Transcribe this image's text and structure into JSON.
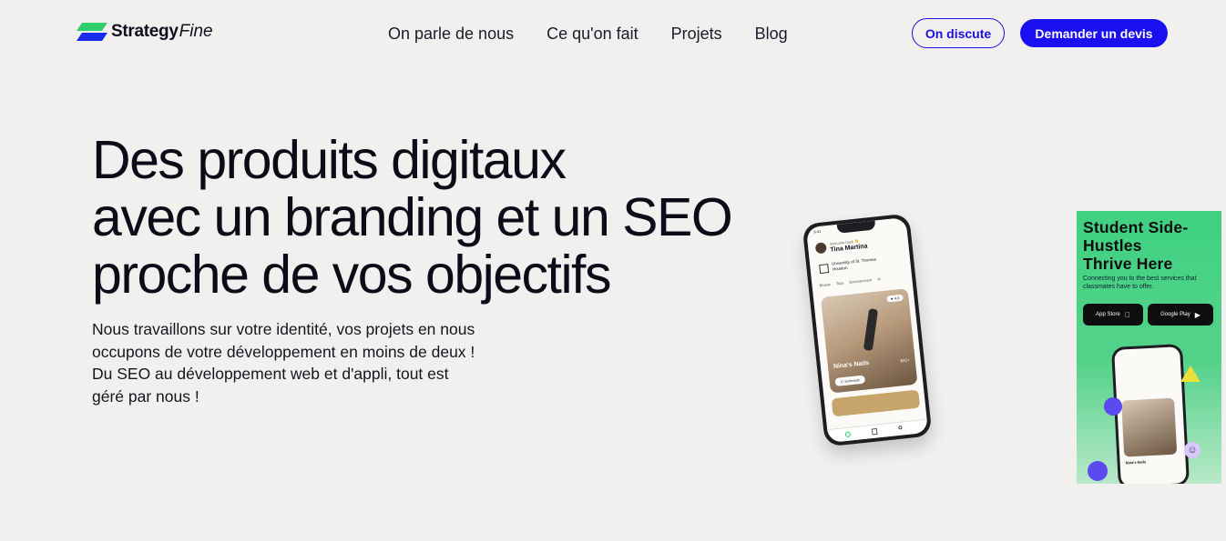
{
  "header": {
    "logo": {
      "strong": "Strategy",
      "em": "Fine"
    },
    "nav": [
      "On parle de nous",
      "Ce qu'on fait",
      "Projets",
      "Blog"
    ],
    "cta_outline": "On discute",
    "cta_solid": "Demander un devis"
  },
  "hero": {
    "headline": [
      "Des produits digitaux",
      "avec un branding et un SEO",
      "proche de vos objectifs"
    ],
    "subtext": [
      "Nous travaillons sur votre identité, vos projets en nous",
      "occupons de votre développement en moins de deux !",
      "Du SEO au développement web et d'appli, tout est",
      "géré par nous !"
    ]
  },
  "phone": {
    "time": "9:41",
    "welcome": "Welcome back 👋",
    "name": "Tina Martina",
    "university": "University of St. Thomas Houston",
    "tabs": [
      "Beauty",
      "Tops",
      "Entertainment",
      "M"
    ],
    "card_title": "Nina's Nails",
    "card_rating": "★ 4.8",
    "card_price": "$45+",
    "card_pill": "⊙ Schedule"
  },
  "ad": {
    "title": [
      "Student Side-",
      "Hustles",
      "Thrive Here"
    ],
    "subtitle": [
      "Connecting you to the best services that",
      "classmates have to offer."
    ],
    "app_store": "App Store",
    "google_play": "Google Play",
    "phone_name": "Nina's Nails"
  },
  "colors": {
    "background": "#f1f0ee",
    "accent": "#1a0ff0",
    "ad_green": "#3fd181",
    "text": "#0c0c18"
  },
  "icons": [
    "logo-mark-icon",
    "apple-icon",
    "google-play-icon",
    "star-icon",
    "home-icon",
    "bag-icon",
    "profile-icon"
  ]
}
